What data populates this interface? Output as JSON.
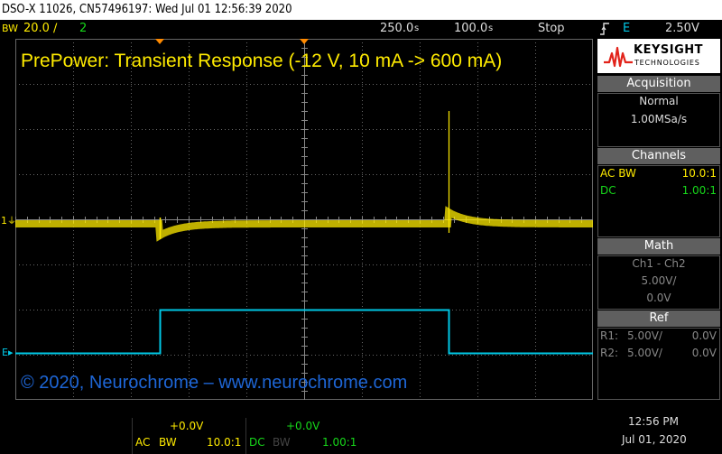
{
  "window_title": "DSO-X 11026, CN57496197: Wed Jul 01 12:56:39 2020",
  "status": {
    "bw_badge": "BW",
    "ch1_scale": "20.0",
    "ch1_scale_unit": "∕",
    "ch2_num": "2",
    "timebase": "250.0",
    "timebase_unit": "s",
    "delay": "100.0",
    "delay_unit": "s",
    "run_state": "Stop",
    "trigger_edge_icon": "trigger-rising-edge",
    "trigger_source": "E",
    "trigger_level": "2.50V"
  },
  "screen": {
    "headline": "PrePower: Transient Response (-12 V, 10 mA -> 600 mA)",
    "copyright": "© 2020, Neurochrome – www.neurochrome.com",
    "ch1_marker": "1",
    "ch2_marker": "E"
  },
  "panel": {
    "brand": "KEYSIGHT",
    "brand_sub": "TECHNOLOGIES",
    "acquisition": {
      "header": "Acquisition",
      "mode": "Normal",
      "rate": "1.00MSa/s"
    },
    "channels": {
      "header": "Channels",
      "rows": [
        {
          "label": "AC BW",
          "value": "10.0:1",
          "color": "#ffeb00"
        },
        {
          "label": "DC",
          "value": "1.00:1",
          "color": "#17d81a"
        }
      ]
    },
    "math": {
      "header": "Math",
      "line1": "Ch1 - Ch2",
      "line2": "5.00V/",
      "line3": "0.0V"
    },
    "ref": {
      "header": "Ref",
      "rows": [
        {
          "name": "R1:",
          "scale": "5.00V/",
          "offset": "0.0V"
        },
        {
          "name": "R2:",
          "scale": "5.00V/",
          "offset": "0.0V"
        }
      ]
    }
  },
  "bottom": {
    "ch1": {
      "offset": "+0.0V",
      "coupling": "AC",
      "bw": "BW",
      "probe": "10.0:1",
      "color": "#ffeb00"
    },
    "ch2": {
      "offset": "+0.0V",
      "coupling": "DC",
      "bw": "BW",
      "probe": "1.00:1",
      "color": "#17d81a"
    },
    "time": "12:56 PM",
    "date": "Jul 01, 2020"
  },
  "colors": {
    "ch1": "#ffeb00",
    "ch2": "#00c8e6",
    "grid": "#666666",
    "headline": "#ffeb00",
    "copyright": "#1e66d6"
  }
}
